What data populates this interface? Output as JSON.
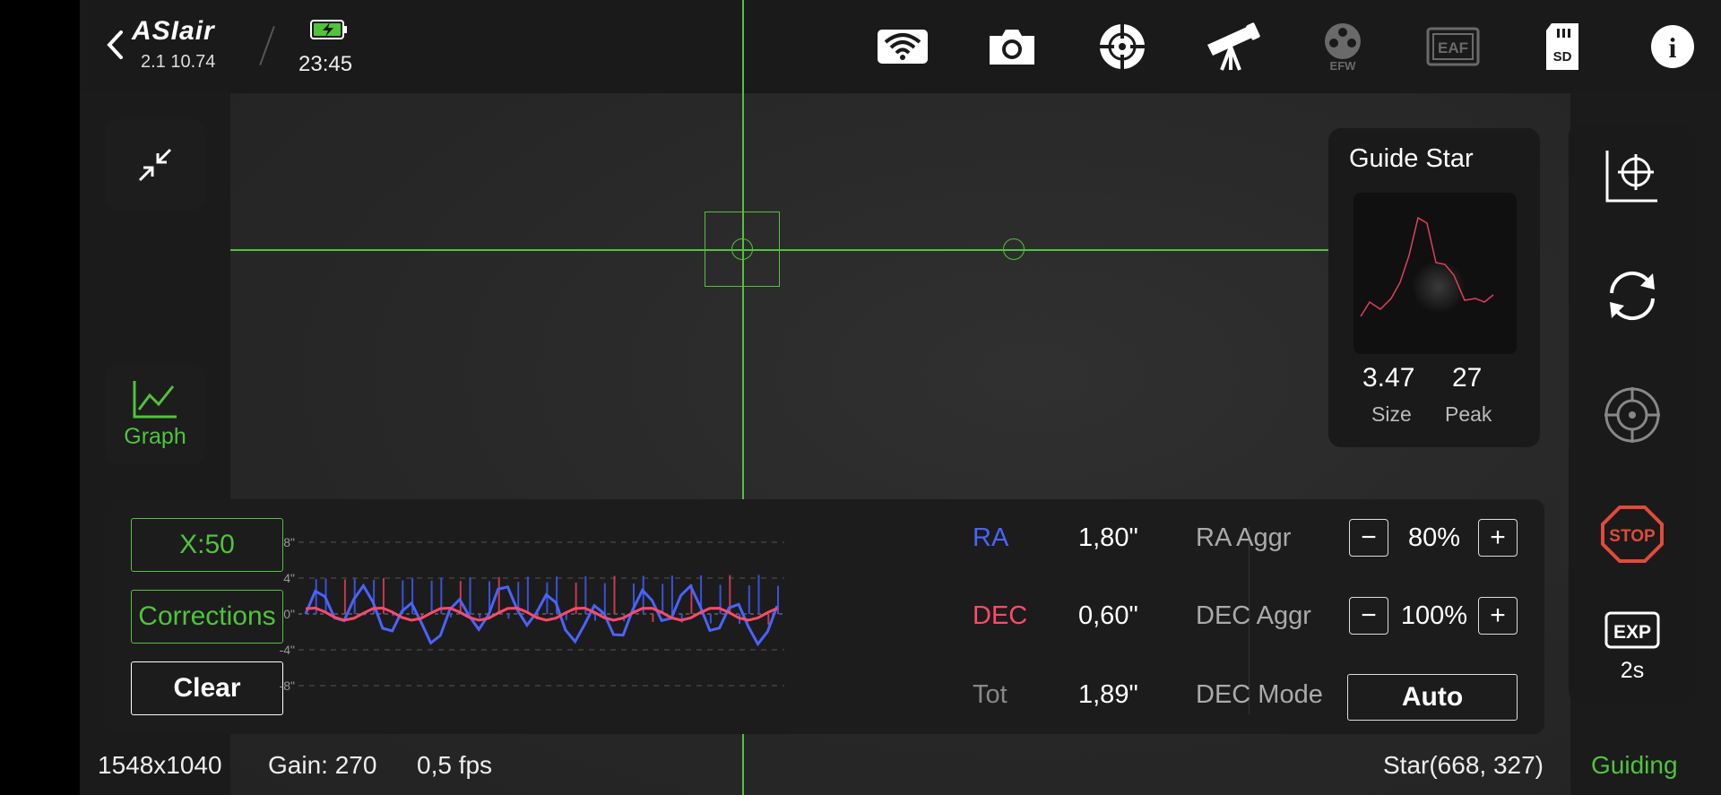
{
  "header": {
    "logo": "ASIair",
    "version": "2.1 10.74",
    "time": "23:45",
    "icons": [
      "wifi-icon",
      "camera-icon",
      "guide-scope-icon",
      "telescope-icon",
      "efw-icon",
      "eaf-icon",
      "sd-card-icon",
      "info-icon"
    ],
    "efw_label": "EFW",
    "eaf_label": "EAF",
    "sd_label": "SD",
    "info_label": "i"
  },
  "left": {
    "graph_label": "Graph"
  },
  "guide_star": {
    "title": "Guide Star",
    "size_value": "3.47",
    "size_label": "Size",
    "peak_value": "27",
    "peak_label": "Peak"
  },
  "right_panel": {
    "stop_label": "STOP",
    "exp_icon_label": "EXP",
    "exp_value": "2s"
  },
  "guide_graph": {
    "x_scale": "X:50",
    "corrections": "Corrections",
    "clear": "Clear",
    "y_ticks": [
      "8\"",
      "4\"",
      "0\"",
      "-4\"",
      "-8\""
    ],
    "ra_label": "RA",
    "ra_value": "1,80\"",
    "dec_label": "DEC",
    "dec_value": "0,60\"",
    "tot_label": "Tot",
    "tot_value": "1,89\"",
    "ra_aggr_label": "RA Aggr",
    "ra_aggr_value": "80%",
    "dec_aggr_label": "DEC Aggr",
    "dec_aggr_value": "100%",
    "dec_mode_label": "DEC Mode",
    "dec_mode_value": "Auto",
    "minus": "−",
    "plus": "+"
  },
  "status": {
    "resolution": "1548x1040",
    "gain": "Gain: 270",
    "fps": "0,5 fps",
    "star": "Star(668, 327)",
    "state": "Guiding"
  },
  "colors": {
    "accent_green": "#4fc43a",
    "ra_blue": "#4a63ff",
    "dec_red": "#ff4a6a",
    "stop_red": "#e24a3b"
  }
}
